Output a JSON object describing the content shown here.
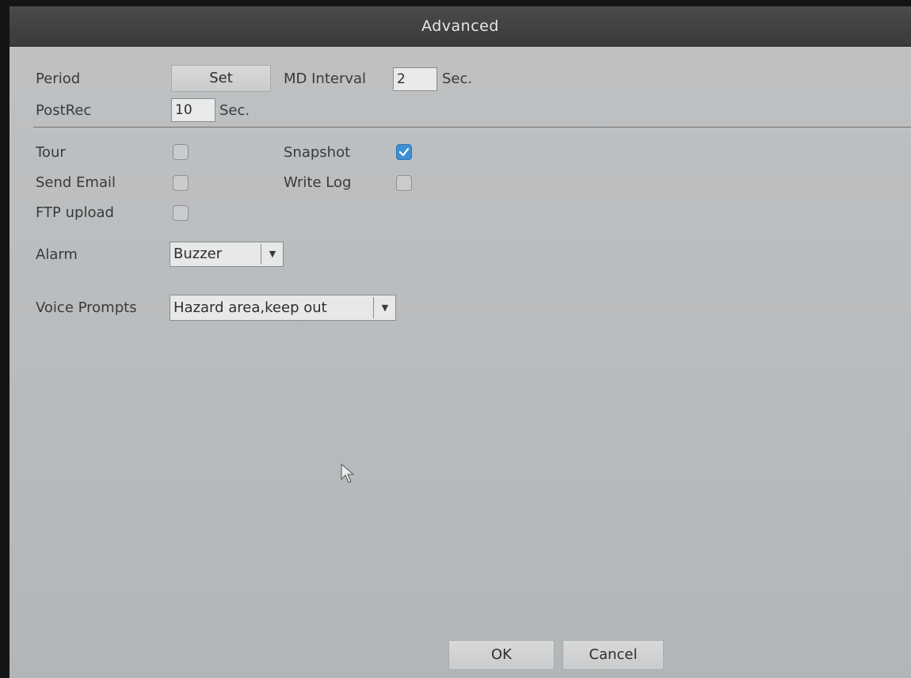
{
  "window": {
    "title": "Advanced"
  },
  "period": {
    "label": "Period",
    "button_label": "Set"
  },
  "md_interval": {
    "label": "MD Interval",
    "value": "2",
    "unit": "Sec."
  },
  "post_rec": {
    "label": "PostRec",
    "value": "10",
    "unit": "Sec."
  },
  "options": {
    "tour": {
      "label": "Tour",
      "checked": false
    },
    "send_email": {
      "label": "Send Email",
      "checked": false
    },
    "ftp_upload": {
      "label": "FTP upload",
      "checked": false
    },
    "snapshot": {
      "label": "Snapshot",
      "checked": true
    },
    "write_log": {
      "label": "Write Log",
      "checked": false
    }
  },
  "alarm": {
    "label": "Alarm",
    "selected": "Buzzer"
  },
  "voice_prompts": {
    "label": "Voice Prompts",
    "selected": "Hazard area,keep out"
  },
  "footer": {
    "ok_label": "OK",
    "cancel_label": "Cancel"
  },
  "colors": {
    "checked_accent": "#3d8fd6",
    "titlebar": "#3f3f3f",
    "panel": "#bbbdbf"
  },
  "icons": {
    "checkmark": "check-icon",
    "dropdown": "dropdown-arrow-icon",
    "pointer": "mouse-pointer-icon"
  }
}
